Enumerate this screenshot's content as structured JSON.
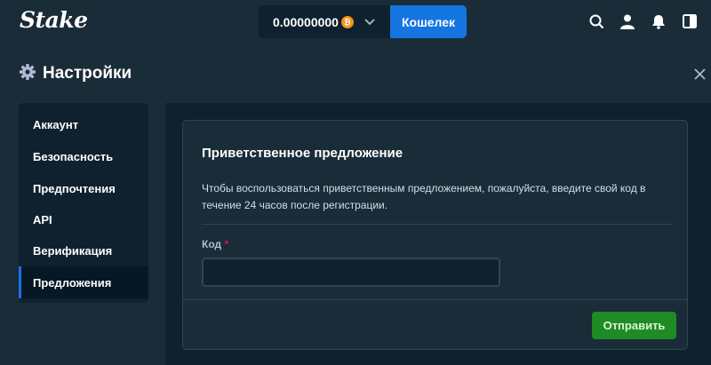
{
  "header": {
    "logo": "Stake",
    "balance": "0.00000000",
    "currency_icon": "bitcoin-icon",
    "currency_symbol": "₿",
    "wallet_label": "Кошелек",
    "icons": [
      "search-icon",
      "user-icon",
      "bell-icon",
      "sidebar-toggle-icon"
    ]
  },
  "page": {
    "title": "Настройки",
    "title_icon": "gear-icon",
    "close_icon": "close-icon"
  },
  "sidebar": {
    "items": [
      {
        "label": "Аккаунт",
        "active": false
      },
      {
        "label": "Безопасность",
        "active": false
      },
      {
        "label": "Предпочтения",
        "active": false
      },
      {
        "label": "API",
        "active": false
      },
      {
        "label": "Верификация",
        "active": false
      },
      {
        "label": "Предложения",
        "active": true
      }
    ]
  },
  "offer": {
    "title": "Приветственное предложение",
    "description": "Чтобы воспользоваться приветственным предложением, пожалуйста, введите свой код в течение 24 часов после регистрации.",
    "code_label": "Код",
    "required_mark": "*",
    "code_value": "",
    "submit_label": "Отправить"
  },
  "colors": {
    "background": "#1a2c38",
    "panel": "#0f212e",
    "accent_blue": "#1475e1",
    "submit_green": "#1f8b24",
    "bitcoin": "#f7931a",
    "required_red": "#e9113c"
  }
}
